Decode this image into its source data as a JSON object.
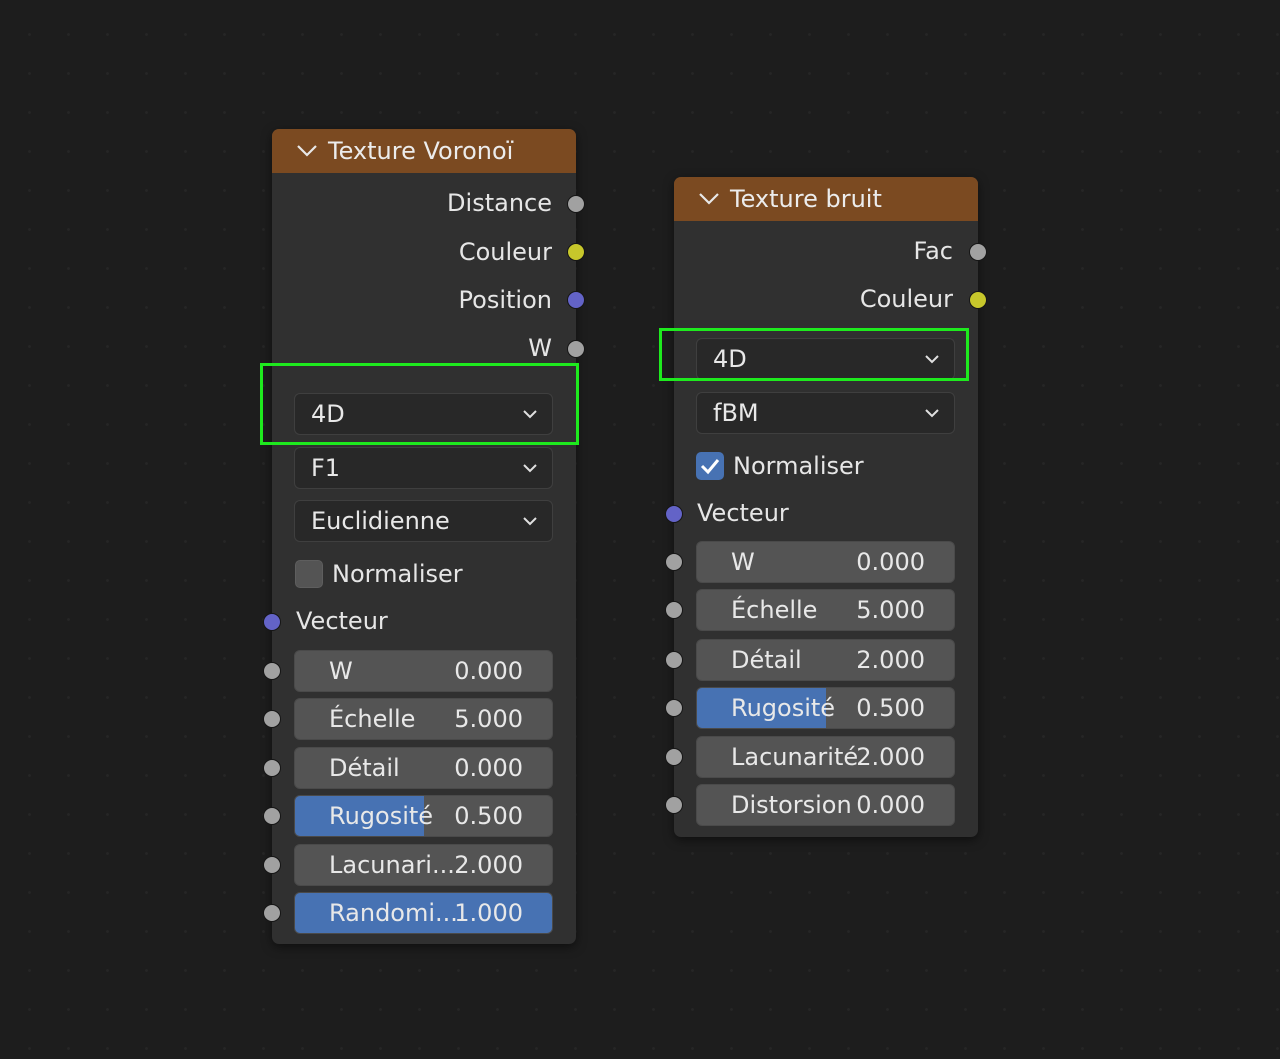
{
  "voronoi": {
    "title": "Texture Voronoï",
    "outputs": [
      "Distance",
      "Couleur",
      "Position",
      "W"
    ],
    "dimensions": "4D",
    "feature": "F1",
    "metric": "Euclidienne",
    "normalize_label": "Normaliser",
    "normalize_checked": false,
    "vector_label": "Vecteur",
    "fields": [
      {
        "label": "W",
        "value": "0.000",
        "fill": 0
      },
      {
        "label": "Échelle",
        "value": "5.000",
        "fill": 0
      },
      {
        "label": "Détail",
        "value": "0.000",
        "fill": 0
      },
      {
        "label": "Rugosité",
        "value": "0.500",
        "fill": 0.5
      },
      {
        "label": "Lacunari...",
        "value": "2.000",
        "fill": 0
      },
      {
        "label": "Randomi...",
        "value": "1.000",
        "fill": 1.0
      }
    ]
  },
  "noise": {
    "title": "Texture bruit",
    "outputs": [
      "Fac",
      "Couleur"
    ],
    "dimensions": "4D",
    "type": "fBM",
    "normalize_label": "Normaliser",
    "normalize_checked": true,
    "vector_label": "Vecteur",
    "fields": [
      {
        "label": "W",
        "value": "0.000",
        "fill": 0
      },
      {
        "label": "Échelle",
        "value": "5.000",
        "fill": 0
      },
      {
        "label": "Détail",
        "value": "2.000",
        "fill": 0
      },
      {
        "label": "Rugosité",
        "value": "0.500",
        "fill": 0.5
      },
      {
        "label": "Lacunarité",
        "value": "2.000",
        "fill": 0
      },
      {
        "label": "Distorsion",
        "value": "0.000",
        "fill": 0
      }
    ]
  },
  "colors": {
    "header": "#7b4a21",
    "highlight": "#1eea1e",
    "accent": "#4772b3",
    "socket_grey": "#a1a1a1",
    "socket_yellow": "#c7c72b",
    "socket_purple": "#6363c7"
  }
}
